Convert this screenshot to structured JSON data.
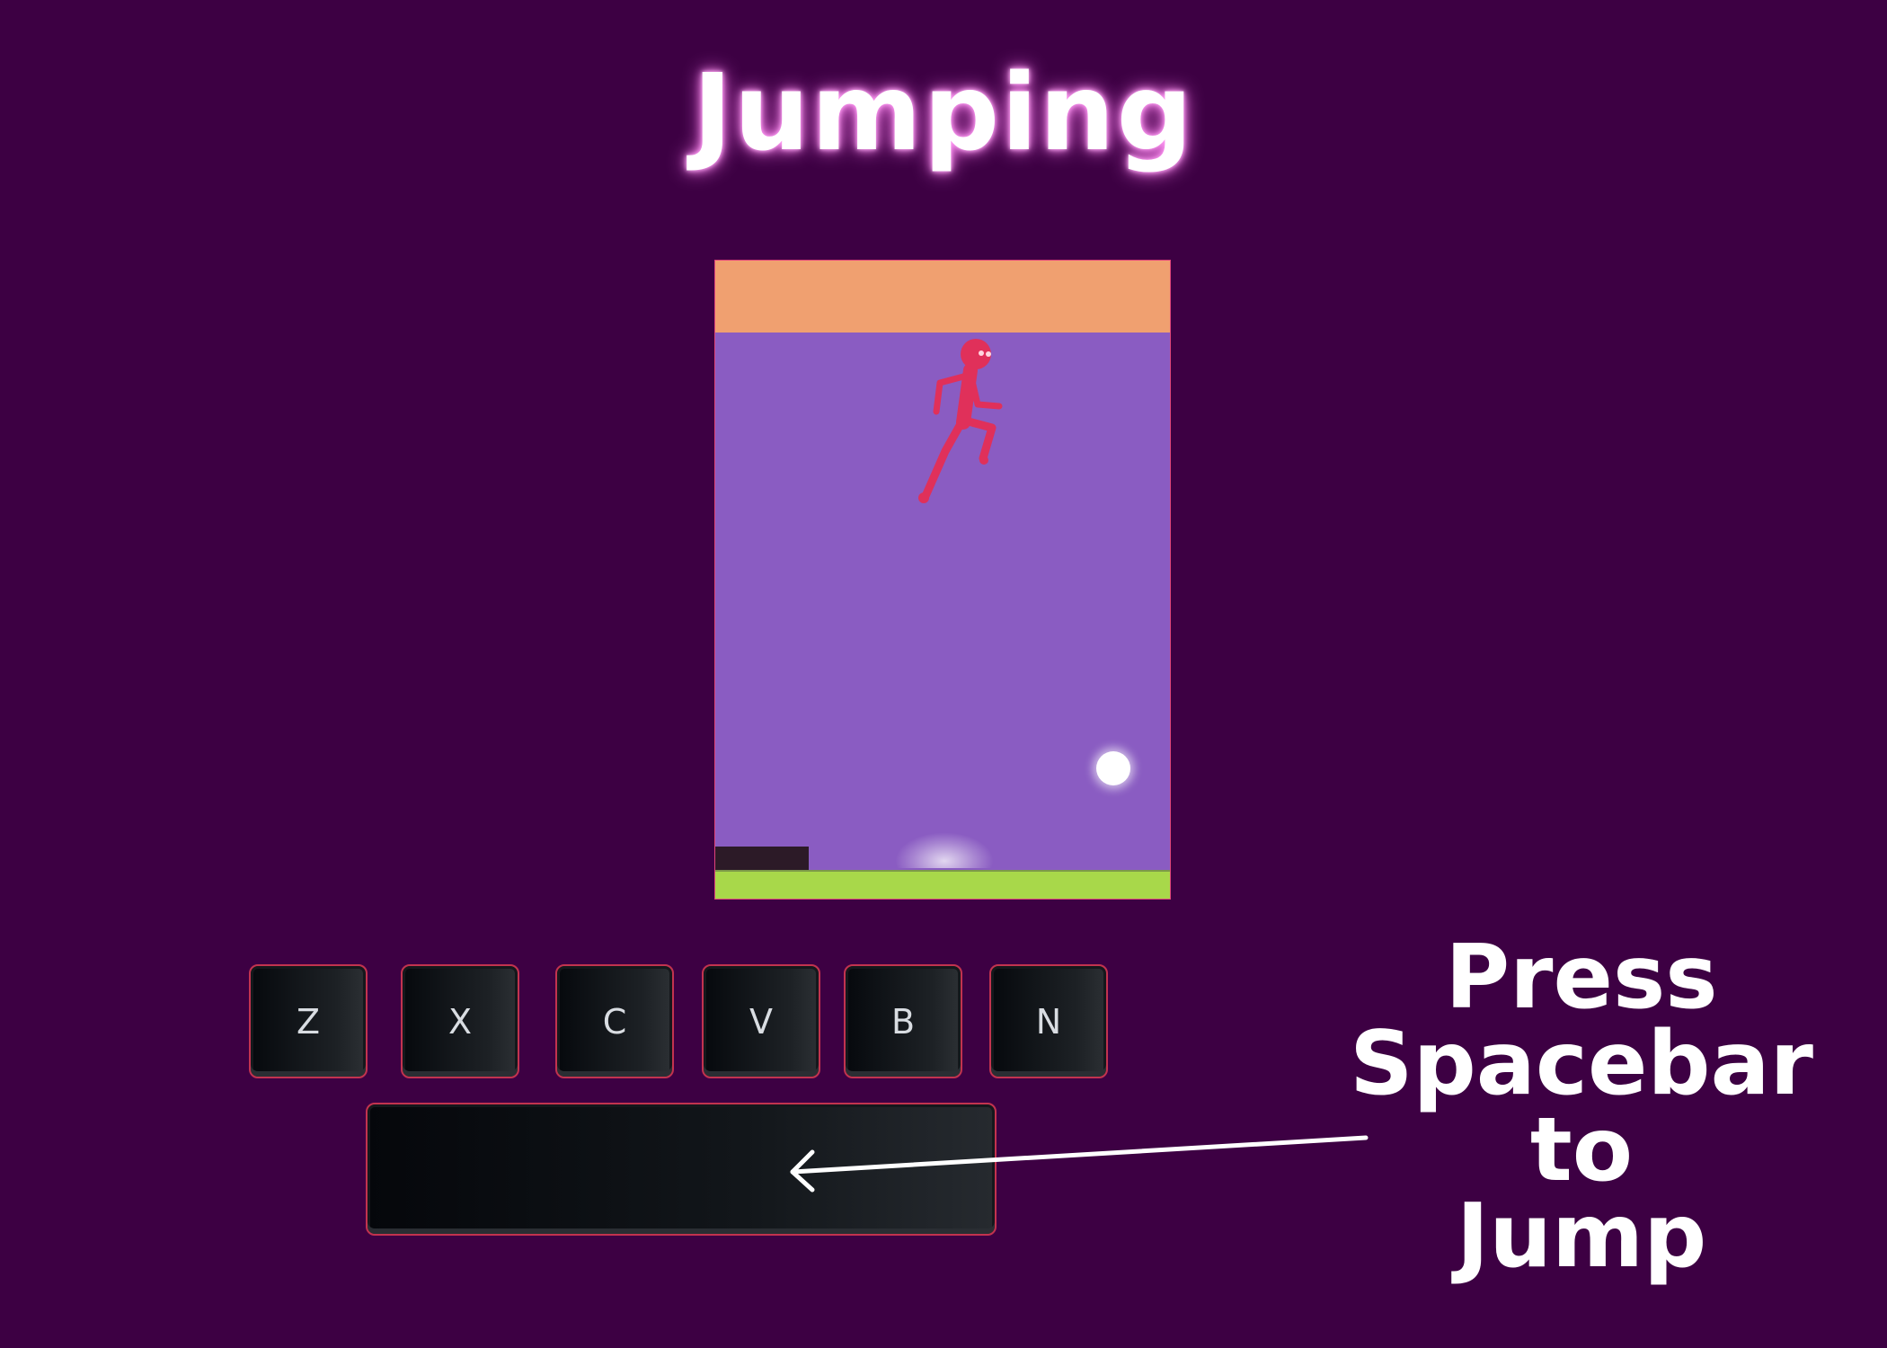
{
  "title": "Jumping",
  "keyboard": {
    "keys": [
      "Z",
      "X",
      "C",
      "V",
      "B",
      "N"
    ]
  },
  "instruction": {
    "lines": [
      "Press",
      "Spacebar",
      "to",
      "Jump"
    ]
  },
  "colors": {
    "background": "#3d0043",
    "play_area": "#8a5cc2",
    "sky_band": "#f0a070",
    "ground": "#a8d84a",
    "character": "#e0305a",
    "key_border": "#c2334f"
  },
  "icons": {
    "arrow": "arrow-left-icon"
  }
}
